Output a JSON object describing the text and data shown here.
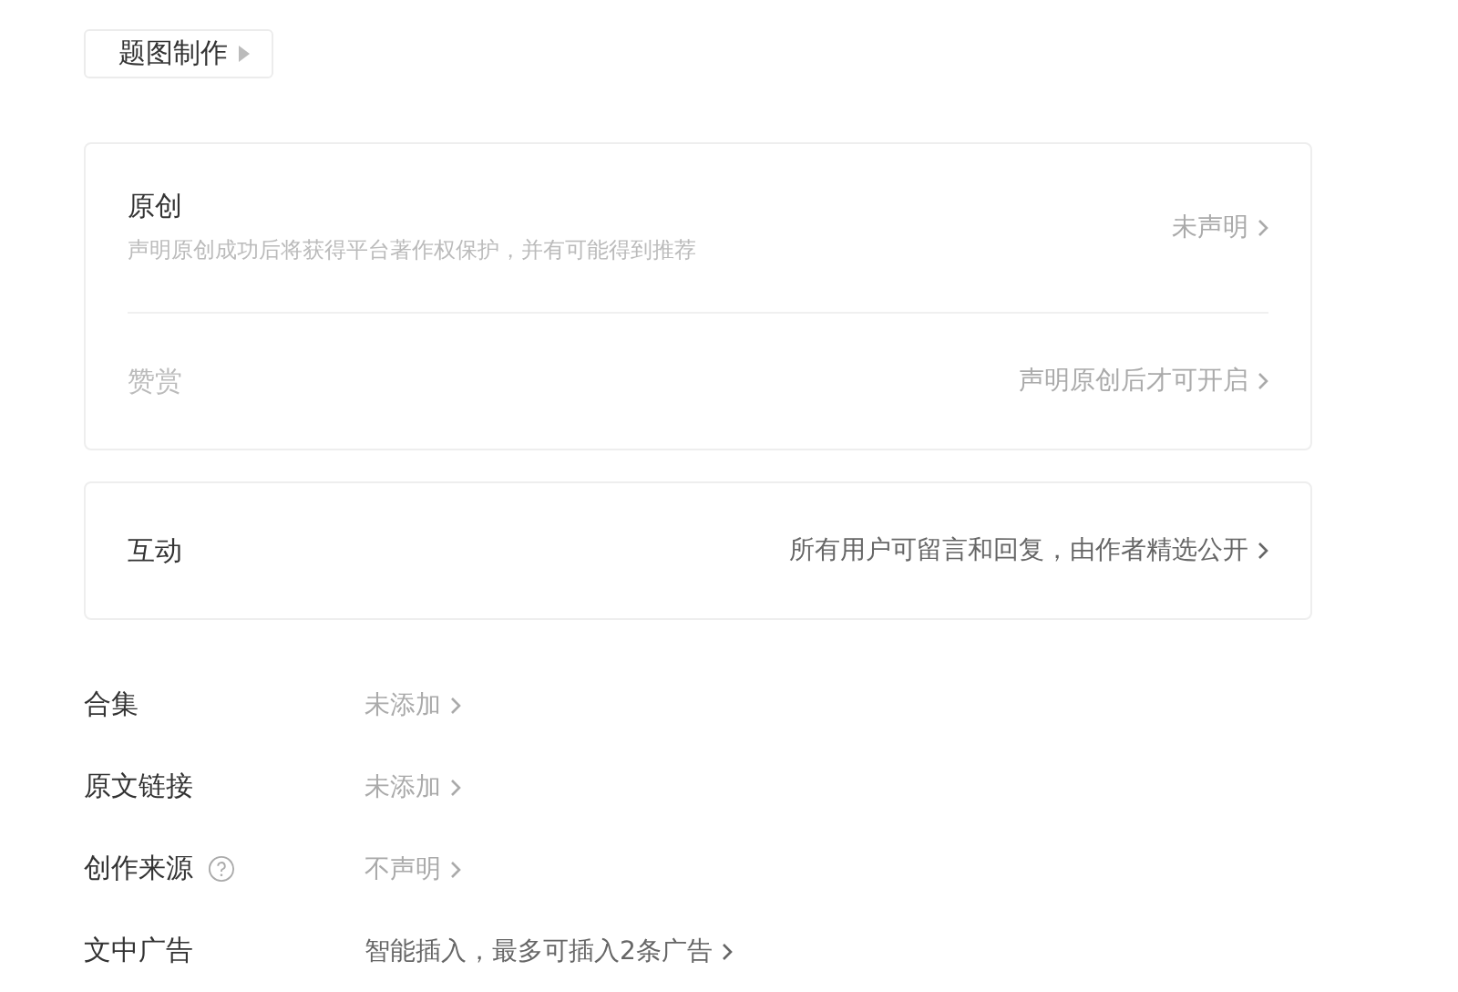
{
  "title_image_button": {
    "label": "题图制作"
  },
  "declaration_card": {
    "rows": [
      {
        "label": "原创",
        "description": "声明原创成功后将获得平台著作权保护，并有可能得到推荐",
        "value": "未声明",
        "disabled": false
      },
      {
        "label": "赞赏",
        "value": "声明原创后才可开启",
        "disabled": true
      }
    ]
  },
  "interaction_card": {
    "label": "互动",
    "value": "所有用户可留言和回复，由作者精选公开"
  },
  "settings": [
    {
      "label": "合集",
      "value": "未添加",
      "dimmed": true,
      "help": false
    },
    {
      "label": "原文链接",
      "value": "未添加",
      "dimmed": true,
      "help": false
    },
    {
      "label": "创作来源",
      "value": "不声明",
      "dimmed": true,
      "help": true
    },
    {
      "label": "文中广告",
      "value": "智能插入，最多可插入2条广告",
      "dimmed": false,
      "help": false
    }
  ]
}
